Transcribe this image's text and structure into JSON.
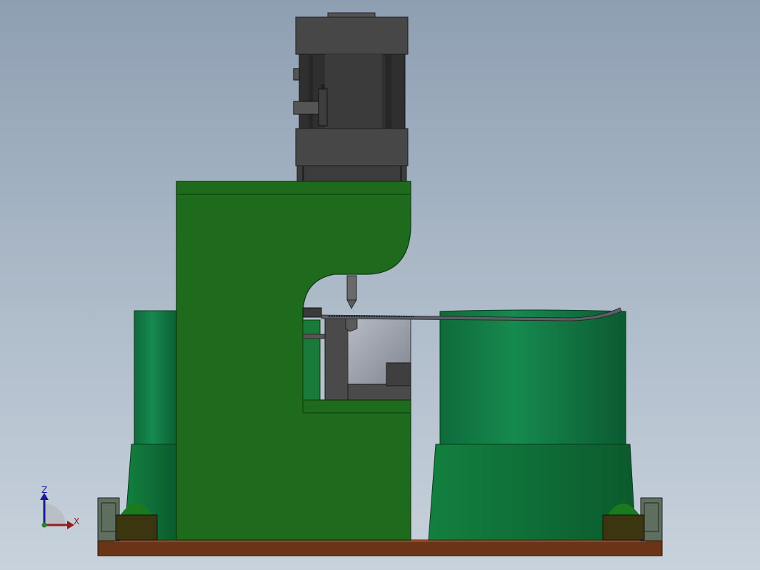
{
  "view": {
    "colors": {
      "frame_green": "#1e6b1e",
      "frame_green_dark": "#155215",
      "cylinder_green": "#127a45",
      "motor_gray": "#4a4a4a",
      "motor_dark": "#2f2f2f",
      "base_brown": "#6b3417",
      "plate_gray": "#8a8f99"
    }
  },
  "triad": {
    "z_label": "Z",
    "x_label": "X",
    "z_color": "#1a1a9a",
    "x_color": "#9a1a1a"
  }
}
